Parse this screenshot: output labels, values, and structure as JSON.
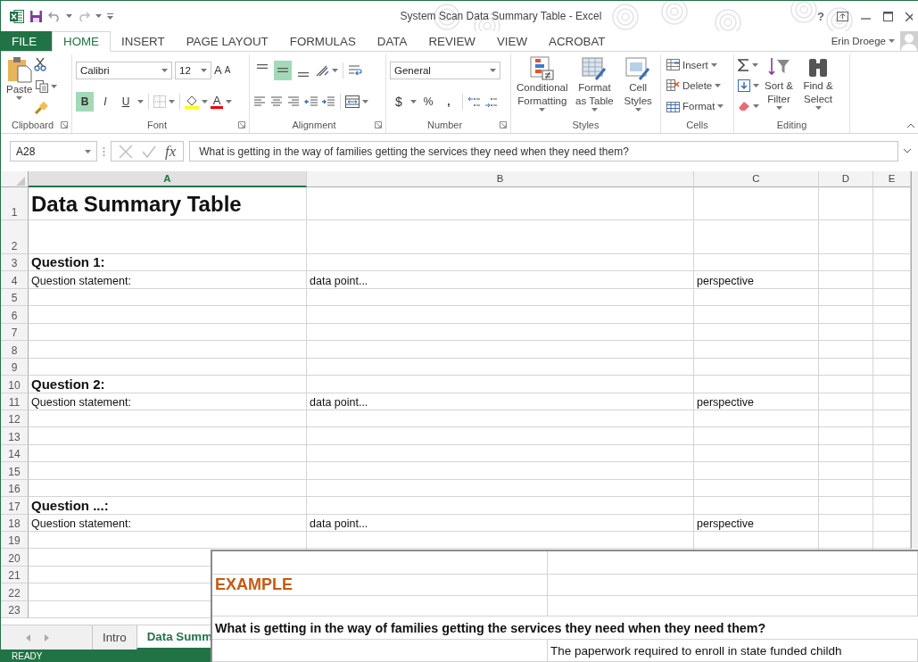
{
  "window": {
    "title": "System Scan Data Summary Table - Excel",
    "help": "?",
    "user": "Erin Droege"
  },
  "ribbon_tabs": [
    {
      "label": "FILE",
      "kind": "file",
      "selected": false
    },
    {
      "label": "HOME",
      "kind": "tab",
      "selected": true
    },
    {
      "label": "INSERT",
      "kind": "tab",
      "selected": false
    },
    {
      "label": "PAGE LAYOUT",
      "kind": "tab",
      "selected": false
    },
    {
      "label": "FORMULAS",
      "kind": "tab",
      "selected": false
    },
    {
      "label": "DATA",
      "kind": "tab",
      "selected": false
    },
    {
      "label": "REVIEW",
      "kind": "tab",
      "selected": false
    },
    {
      "label": "VIEW",
      "kind": "tab",
      "selected": false
    },
    {
      "label": "ACROBAT",
      "kind": "tab",
      "selected": false
    }
  ],
  "clipboard": {
    "paste": "Paste",
    "label": "Clipboard"
  },
  "font": {
    "name": "Calibri",
    "size": "12",
    "grow": "A",
    "shrink": "A",
    "styles": [
      {
        "label": "B",
        "selected": true
      },
      {
        "label": "I",
        "selected": false
      },
      {
        "label": "U",
        "selected": false
      }
    ],
    "color_letter": "A",
    "label": "Font"
  },
  "alignment": {
    "vertical": [
      {
        "selected": false
      },
      {
        "selected": true
      },
      {
        "selected": false
      }
    ],
    "label": "Alignment"
  },
  "number": {
    "format": "General",
    "currency": "$",
    "percent": "%",
    "comma": ",",
    "label": "Number"
  },
  "styles": {
    "buttons": [
      "Conditional Formatting",
      "Format as Table",
      "Cell Styles"
    ],
    "label": "Styles"
  },
  "cells": {
    "buttons": [
      "Insert",
      "Delete",
      "Format"
    ],
    "label": "Cells"
  },
  "editing": {
    "buttons": [
      "Sort & Filter",
      "Find & Select"
    ],
    "label": "Editing"
  },
  "formula_bar": {
    "name_box": "A28",
    "function_label": "fx",
    "value": "What is getting in the way of families getting the services they need when they need them?"
  },
  "columns": [
    {
      "label": "A",
      "selected": true
    },
    {
      "label": "B",
      "selected": false
    },
    {
      "label": "C",
      "selected": false
    },
    {
      "label": "D",
      "selected": false
    },
    {
      "label": "E",
      "selected": false
    }
  ],
  "rows": [
    {
      "number": "1",
      "kind": "title",
      "cells": {
        "a": "Data Summary Table"
      }
    },
    {
      "number": "2",
      "kind": "spacer"
    },
    {
      "number": "3",
      "kind": "heading",
      "cells": {
        "a": "Question 1:"
      }
    },
    {
      "number": "4",
      "kind": "plain",
      "cells": {
        "a": "Question statement:",
        "b": "data point...",
        "c": "perspective"
      }
    },
    {
      "number": "5",
      "kind": "plain"
    },
    {
      "number": "6",
      "kind": "plain"
    },
    {
      "number": "7",
      "kind": "plain"
    },
    {
      "number": "8",
      "kind": "plain"
    },
    {
      "number": "9",
      "kind": "plain"
    },
    {
      "number": "10",
      "kind": "heading",
      "cells": {
        "a": "Question 2:"
      }
    },
    {
      "number": "11",
      "kind": "plain",
      "cells": {
        "a": "Question statement:",
        "b": "data point...",
        "c": "perspective"
      }
    },
    {
      "number": "12",
      "kind": "plain"
    },
    {
      "number": "13",
      "kind": "plain"
    },
    {
      "number": "14",
      "kind": "plain"
    },
    {
      "number": "15",
      "kind": "plain"
    },
    {
      "number": "16",
      "kind": "plain"
    },
    {
      "number": "17",
      "kind": "heading",
      "cells": {
        "a": "Question ...:"
      }
    },
    {
      "number": "18",
      "kind": "plain",
      "cells": {
        "a": "Question statement:",
        "b": "data point...",
        "c": "perspective"
      }
    },
    {
      "number": "19",
      "kind": "plain"
    },
    {
      "number": "20",
      "kind": "plain"
    },
    {
      "number": "21",
      "kind": "plain"
    },
    {
      "number": "22",
      "kind": "plain"
    },
    {
      "number": "23",
      "kind": "plain"
    }
  ],
  "embedded_sheet": {
    "heading": "EXAMPLE",
    "question": "What is getting in the way of families getting the services they need when they need them?",
    "text": "The paperwork required to enroll in state funded childh"
  },
  "sheet_tabs": [
    {
      "label": "Intro",
      "selected": false
    },
    {
      "label": "Data Summ",
      "selected": true
    }
  ],
  "status_bar": {
    "text": "READY"
  }
}
